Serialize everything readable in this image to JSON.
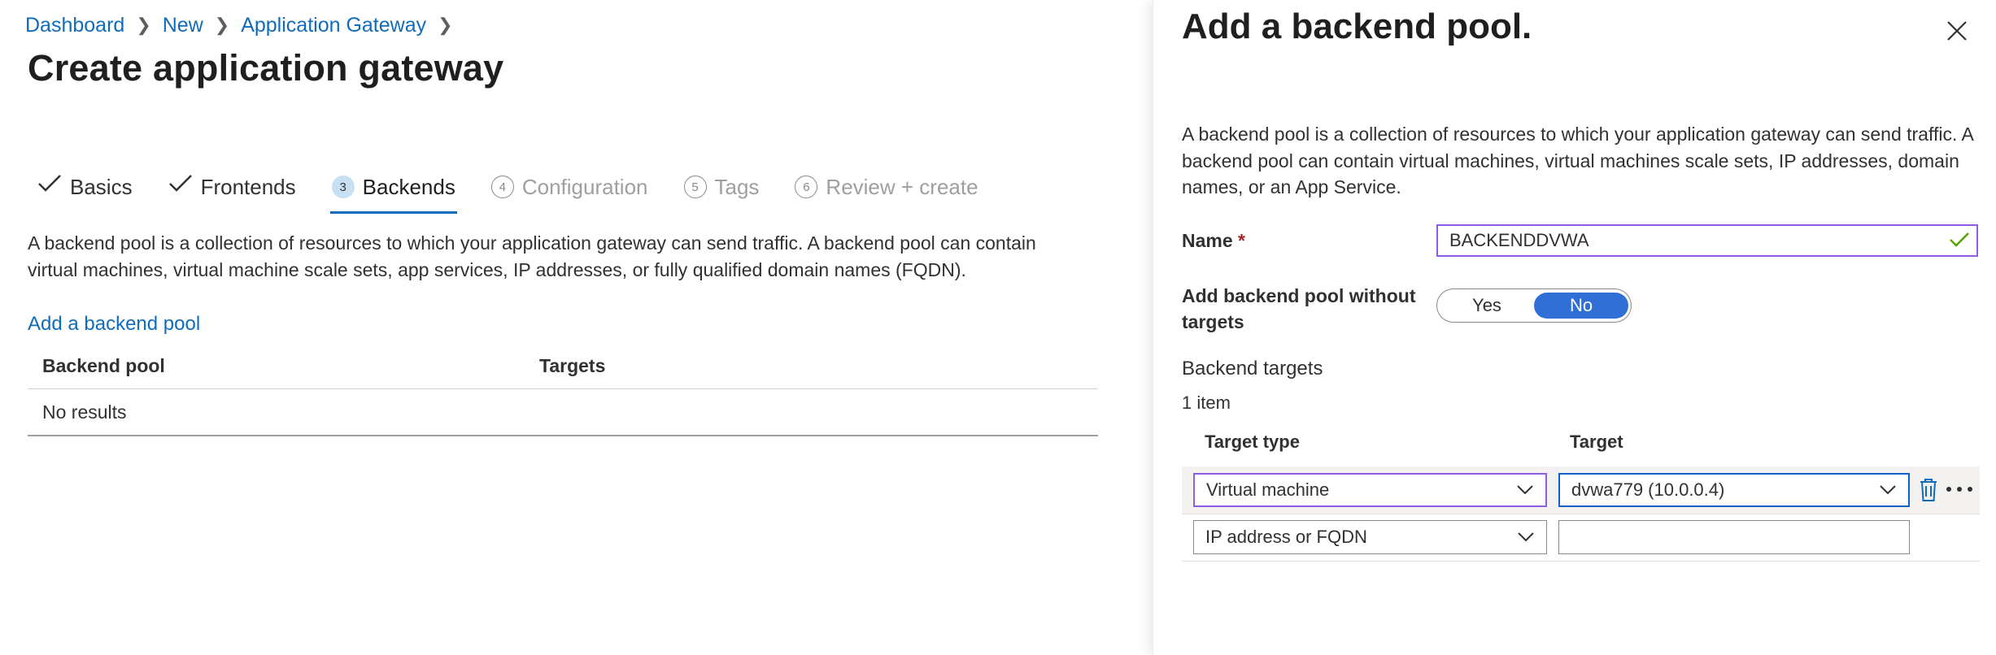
{
  "breadcrumb": {
    "items": [
      "Dashboard",
      "New",
      "Application Gateway"
    ]
  },
  "page_title": "Create application gateway",
  "wizard_tabs": [
    {
      "number": "1",
      "label": "Basics",
      "state": "completed"
    },
    {
      "number": "2",
      "label": "Frontends",
      "state": "completed"
    },
    {
      "number": "3",
      "label": "Backends",
      "state": "active"
    },
    {
      "number": "4",
      "label": "Configuration",
      "state": "upcoming"
    },
    {
      "number": "5",
      "label": "Tags",
      "state": "upcoming"
    },
    {
      "number": "6",
      "label": "Review + create",
      "state": "upcoming"
    }
  ],
  "main": {
    "description": "A backend pool is a collection of resources to which your application gateway can send traffic. A backend pool can contain virtual machines, virtual machine scale sets, app services, IP addresses, or fully qualified domain names (FQDN).",
    "add_pool_link": "Add a backend pool",
    "table": {
      "columns": [
        "Backend pool",
        "Targets"
      ],
      "empty_text": "No results"
    }
  },
  "panel": {
    "title": "Add a backend pool.",
    "description": "A backend pool is a collection of resources to which your application gateway can send traffic. A backend pool can contain virtual machines, virtual machines scale sets, IP addresses, domain names, or an App Service.",
    "name_label": "Name",
    "required_mark": "*",
    "name_value": "BACKENDDVWA",
    "without_targets_label": "Add backend pool without targets",
    "toggle": {
      "yes": "Yes",
      "no": "No",
      "selected": "No"
    },
    "backend_targets_heading": "Backend targets",
    "item_count": "1 item",
    "columns": {
      "target_type": "Target type",
      "target": "Target"
    },
    "rows": [
      {
        "target_type": "Virtual machine",
        "target": "dvwa779 (10.0.0.4)"
      },
      {
        "target_type": "IP address or FQDN",
        "target": ""
      }
    ]
  },
  "colors": {
    "accent": "#0f6cbd",
    "toggle_selected": "#2f6fd6",
    "focus_purple": "#8c5ee6",
    "success_check": "#57a300",
    "required": "#a4262c"
  },
  "icons": [
    "chevron-right-icon",
    "checkmark-icon",
    "close-icon",
    "chevron-down-icon",
    "trash-icon",
    "more-icon"
  ]
}
